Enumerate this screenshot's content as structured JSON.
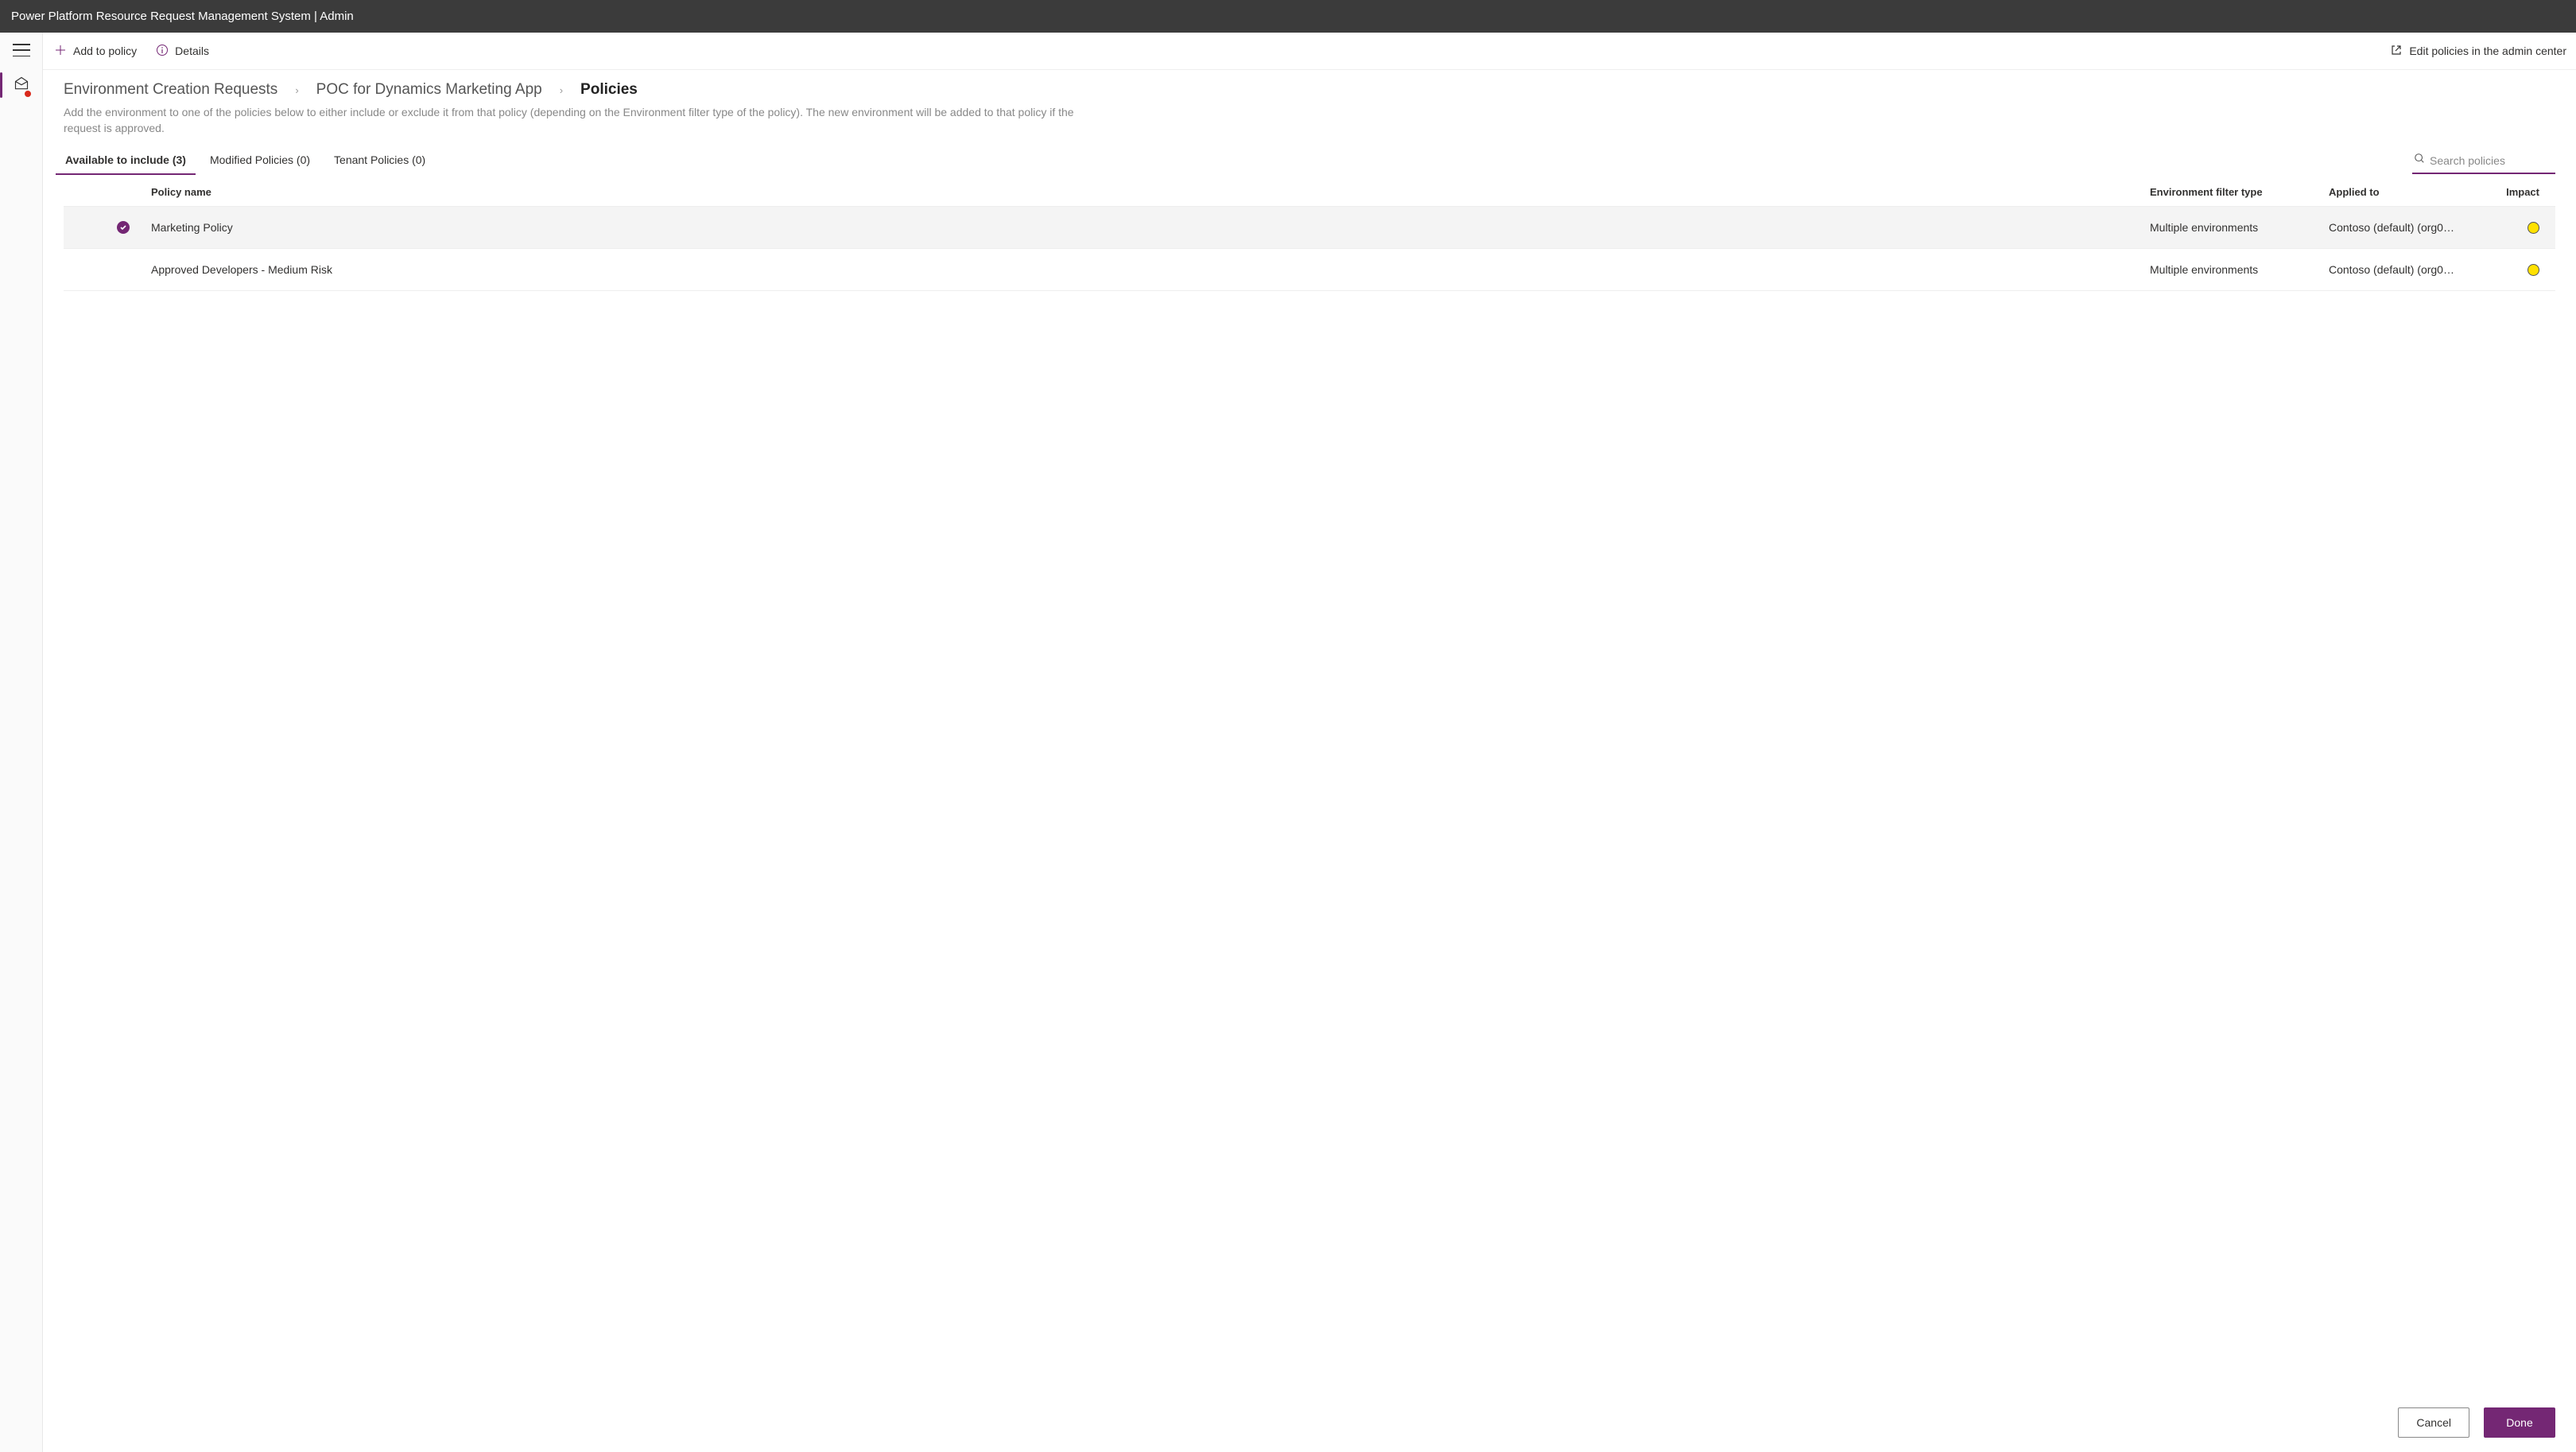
{
  "header": {
    "title": "Power Platform Resource Request Management System | Admin"
  },
  "commandBar": {
    "addToPolicy": "Add to policy",
    "details": "Details",
    "editPoliciesLink": "Edit policies in the admin center"
  },
  "breadcrumb": {
    "item1": "Environment Creation Requests",
    "item2": "POC for Dynamics Marketing App",
    "item3": "Policies"
  },
  "page": {
    "description": "Add the environment to one of the policies below to either include or exclude it from that policy (depending on the Environment filter type of the policy). The new environment will be added to that policy if the request is approved."
  },
  "tabs": {
    "available": "Available to include (3)",
    "modified": "Modified Policies (0)",
    "tenant": "Tenant Policies (0)"
  },
  "search": {
    "placeholder": "Search policies"
  },
  "table": {
    "headers": {
      "policyName": "Policy name",
      "filterType": "Environment filter type",
      "appliedTo": "Applied to",
      "impact": "Impact"
    },
    "rows": [
      {
        "selected": true,
        "name": "Marketing Policy",
        "filterType": "Multiple environments",
        "appliedTo": "Contoso (default) (org0…",
        "impactColor": "#ffe100"
      },
      {
        "selected": false,
        "name": "Approved Developers - Medium Risk",
        "filterType": "Multiple environments",
        "appliedTo": "Contoso (default) (org0…",
        "impactColor": "#ffe100"
      }
    ]
  },
  "footer": {
    "cancel": "Cancel",
    "done": "Done"
  }
}
